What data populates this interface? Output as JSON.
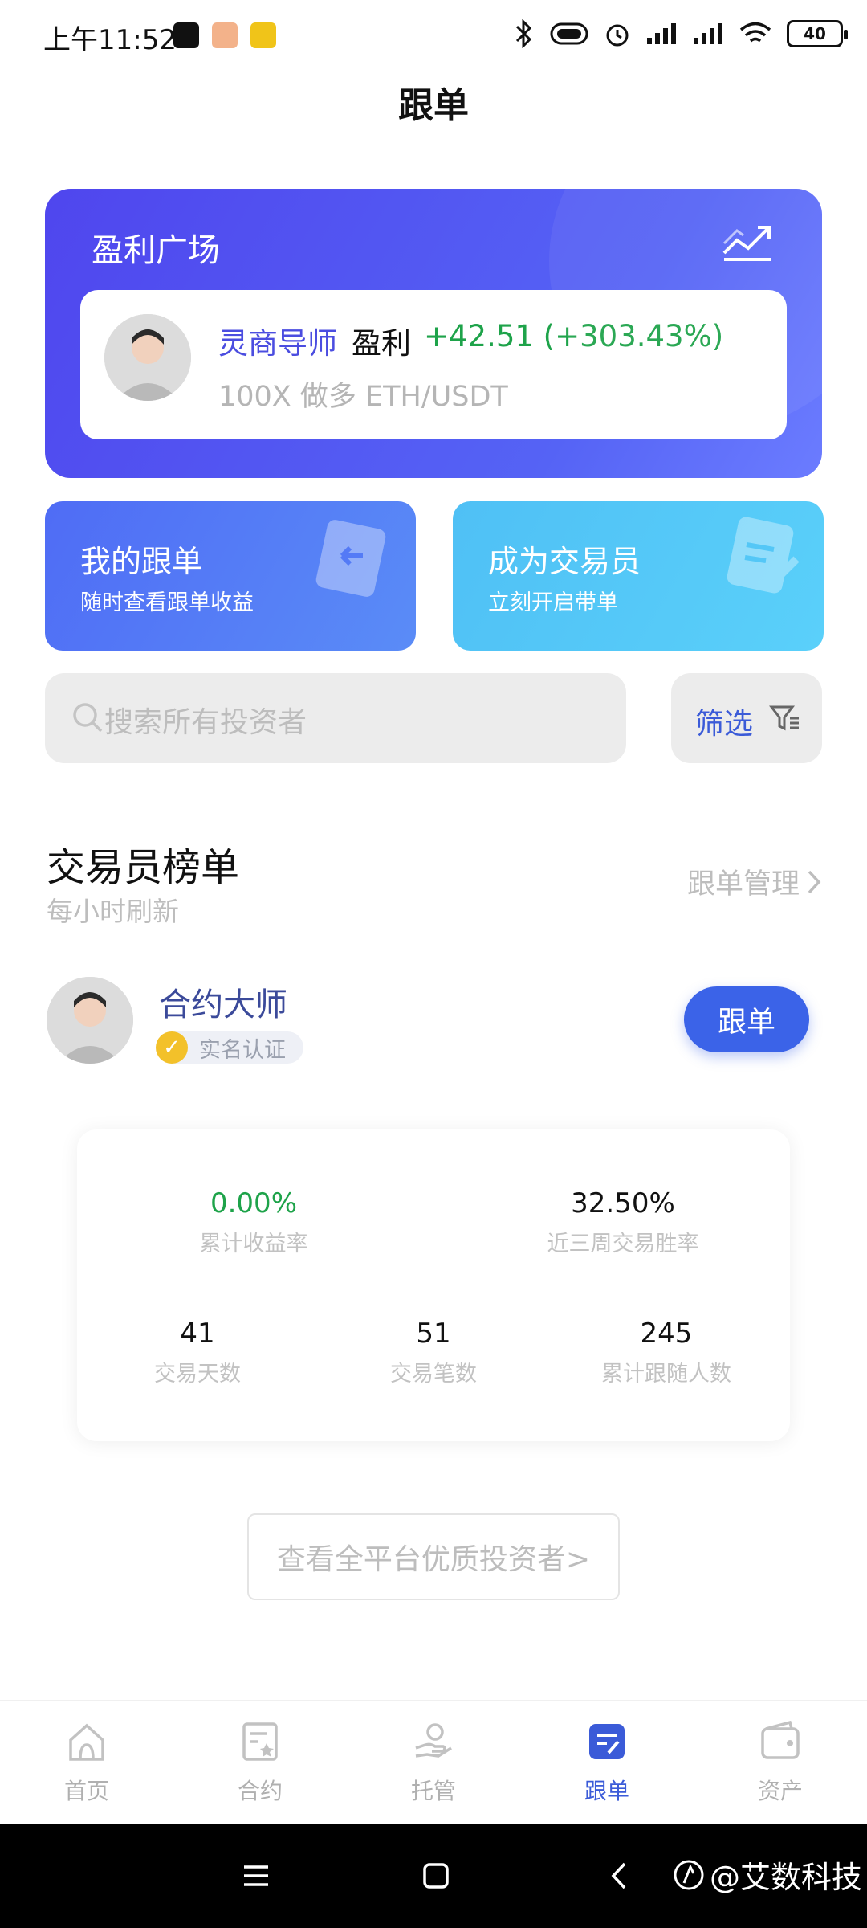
{
  "status_bar": {
    "time": "上午11:52",
    "battery": "40"
  },
  "page": {
    "title": "跟单"
  },
  "plaza": {
    "title": "盈利广场",
    "card": {
      "name": "灵商导师",
      "profit_label": "盈利",
      "profit_value": "+42.51 (+303.43%)",
      "subtitle": "100X 做多 ETH/USDT"
    }
  },
  "actions": {
    "my_follow": {
      "title": "我的跟单",
      "subtitle": "随时查看跟单收益"
    },
    "become_trader": {
      "title": "成为交易员",
      "subtitle": "立刻开启带单"
    }
  },
  "search": {
    "placeholder": "搜索所有投资者"
  },
  "filter": {
    "label": "筛选"
  },
  "leaderboard": {
    "title": "交易员榜单",
    "subtitle": "每小时刷新",
    "manage_label": "跟单管理"
  },
  "trader": {
    "name": "合约大师",
    "verified_label": "实名认证",
    "follow_label": "跟单",
    "stats": {
      "cumulative_return": {
        "value": "0.00%",
        "label": "累计收益率"
      },
      "win_rate": {
        "value": "32.50%",
        "label": "近三周交易胜率"
      },
      "trading_days": {
        "value": "41",
        "label": "交易天数"
      },
      "trades": {
        "value": "51",
        "label": "交易笔数"
      },
      "followers": {
        "value": "245",
        "label": "累计跟随人数"
      }
    }
  },
  "view_all": {
    "label": "查看全平台优质投资者>"
  },
  "bottom_nav": {
    "items": [
      {
        "label": "首页",
        "icon": "home-icon"
      },
      {
        "label": "合约",
        "icon": "contract-icon"
      },
      {
        "label": "托管",
        "icon": "custody-icon"
      },
      {
        "label": "跟单",
        "icon": "copy-trade-icon"
      },
      {
        "label": "资产",
        "icon": "wallet-icon"
      }
    ]
  },
  "watermark": {
    "text": "@艾数科技"
  },
  "colors": {
    "primary": "#3b5bd8",
    "positive": "#1ea34a",
    "plaza_bg": "#5563f5",
    "verify": "#f3c12a"
  }
}
